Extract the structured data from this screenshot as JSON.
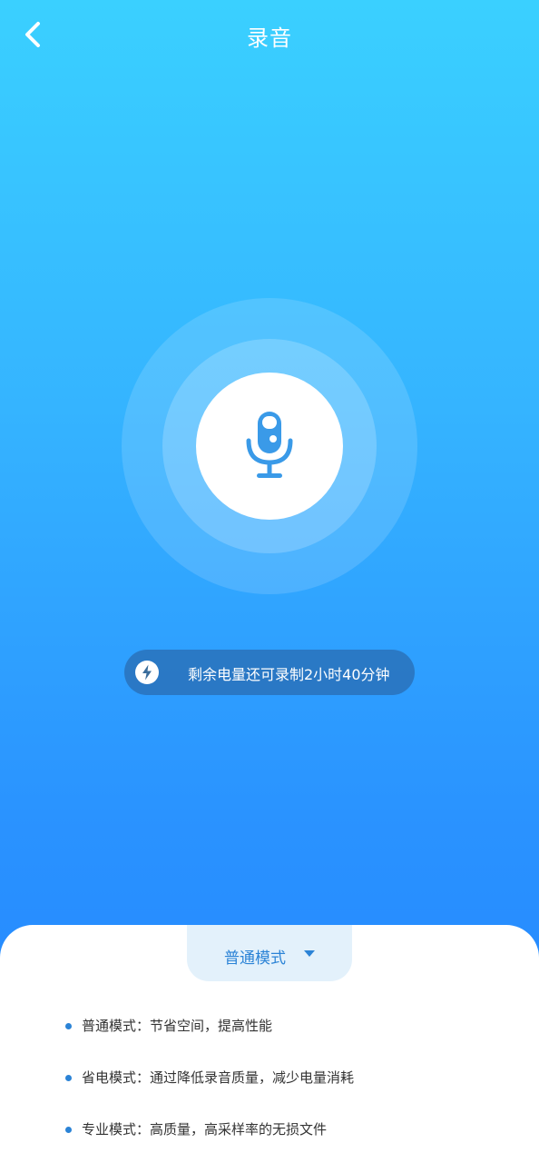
{
  "header": {
    "title": "录音",
    "back_icon": "chevron-left-icon"
  },
  "recorder": {
    "mic_icon": "microphone-icon"
  },
  "battery": {
    "icon": "lightning-bolt-icon",
    "text": "剩余电量还可录制2小时40分钟"
  },
  "mode": {
    "selected": "普通模式",
    "caret_icon": "caret-down-icon"
  },
  "descriptions": [
    {
      "text": "普通模式：节省空间，提高性能"
    },
    {
      "text": "省电模式：通过降低录音质量，减少电量消耗"
    },
    {
      "text": "专业模式：高质量，高采样率的无损文件"
    }
  ],
  "colors": {
    "accent": "#2b83d6",
    "mic_blue": "#3a9ae8",
    "gradient_top": "#3ad0ff",
    "gradient_bottom": "#2283ff"
  }
}
